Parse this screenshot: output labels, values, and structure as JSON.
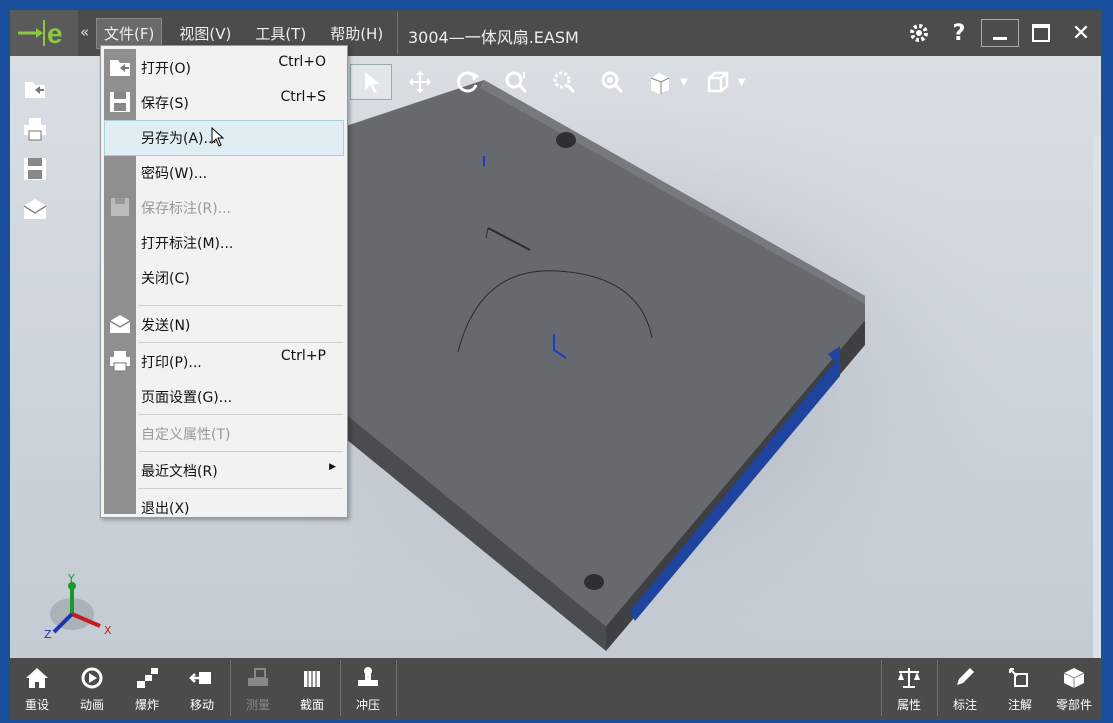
{
  "titlebar": {
    "menu": [
      "文件(F)",
      "视图(V)",
      "工具(T)",
      "帮助(H)"
    ],
    "doc_title": "3004—一体风扇.EASM",
    "help": "?"
  },
  "file_menu": {
    "items": [
      {
        "label": "打开(O)",
        "shortcut": "Ctrl+O",
        "icon": "open-icon"
      },
      {
        "label": "保存(S)",
        "shortcut": "Ctrl+S",
        "icon": "save-icon"
      },
      {
        "label": "另存为(A)...",
        "shortcut": "",
        "icon": ""
      },
      {
        "label": "密码(W)...",
        "shortcut": "",
        "icon": ""
      },
      {
        "label": "保存标注(R)...",
        "shortcut": "",
        "icon": "save-markup-icon",
        "disabled": true
      },
      {
        "label": "打开标注(M)...",
        "shortcut": "",
        "icon": ""
      },
      {
        "label": "关闭(C)",
        "shortcut": "",
        "icon": ""
      },
      {
        "label": "发送(N)",
        "shortcut": "",
        "icon": "send-icon"
      },
      {
        "label": "打印(P)...",
        "shortcut": "Ctrl+P",
        "icon": "print-icon"
      },
      {
        "label": "页面设置(G)...",
        "shortcut": "",
        "icon": ""
      },
      {
        "label": "自定义属性(T)",
        "shortcut": "",
        "icon": "",
        "disabled": true
      },
      {
        "label": "最近文档(R)",
        "shortcut": "",
        "icon": "",
        "submenu": true
      },
      {
        "label": "退出(X)",
        "shortcut": "",
        "icon": ""
      }
    ]
  },
  "bottom_toolbar": {
    "left": [
      "重设",
      "动画",
      "爆炸",
      "移动",
      "测量",
      "截面",
      "冲压"
    ],
    "right": [
      "属性",
      "标注",
      "注解",
      "零部件"
    ]
  },
  "axes": {
    "x": "X",
    "y": "Y",
    "z": "Z"
  },
  "colors": {
    "titlebar": "#4c4c4c",
    "accent_blue": "#1a4f9e",
    "logo_green": "#8dc63f",
    "model_gray": "#66696d"
  }
}
